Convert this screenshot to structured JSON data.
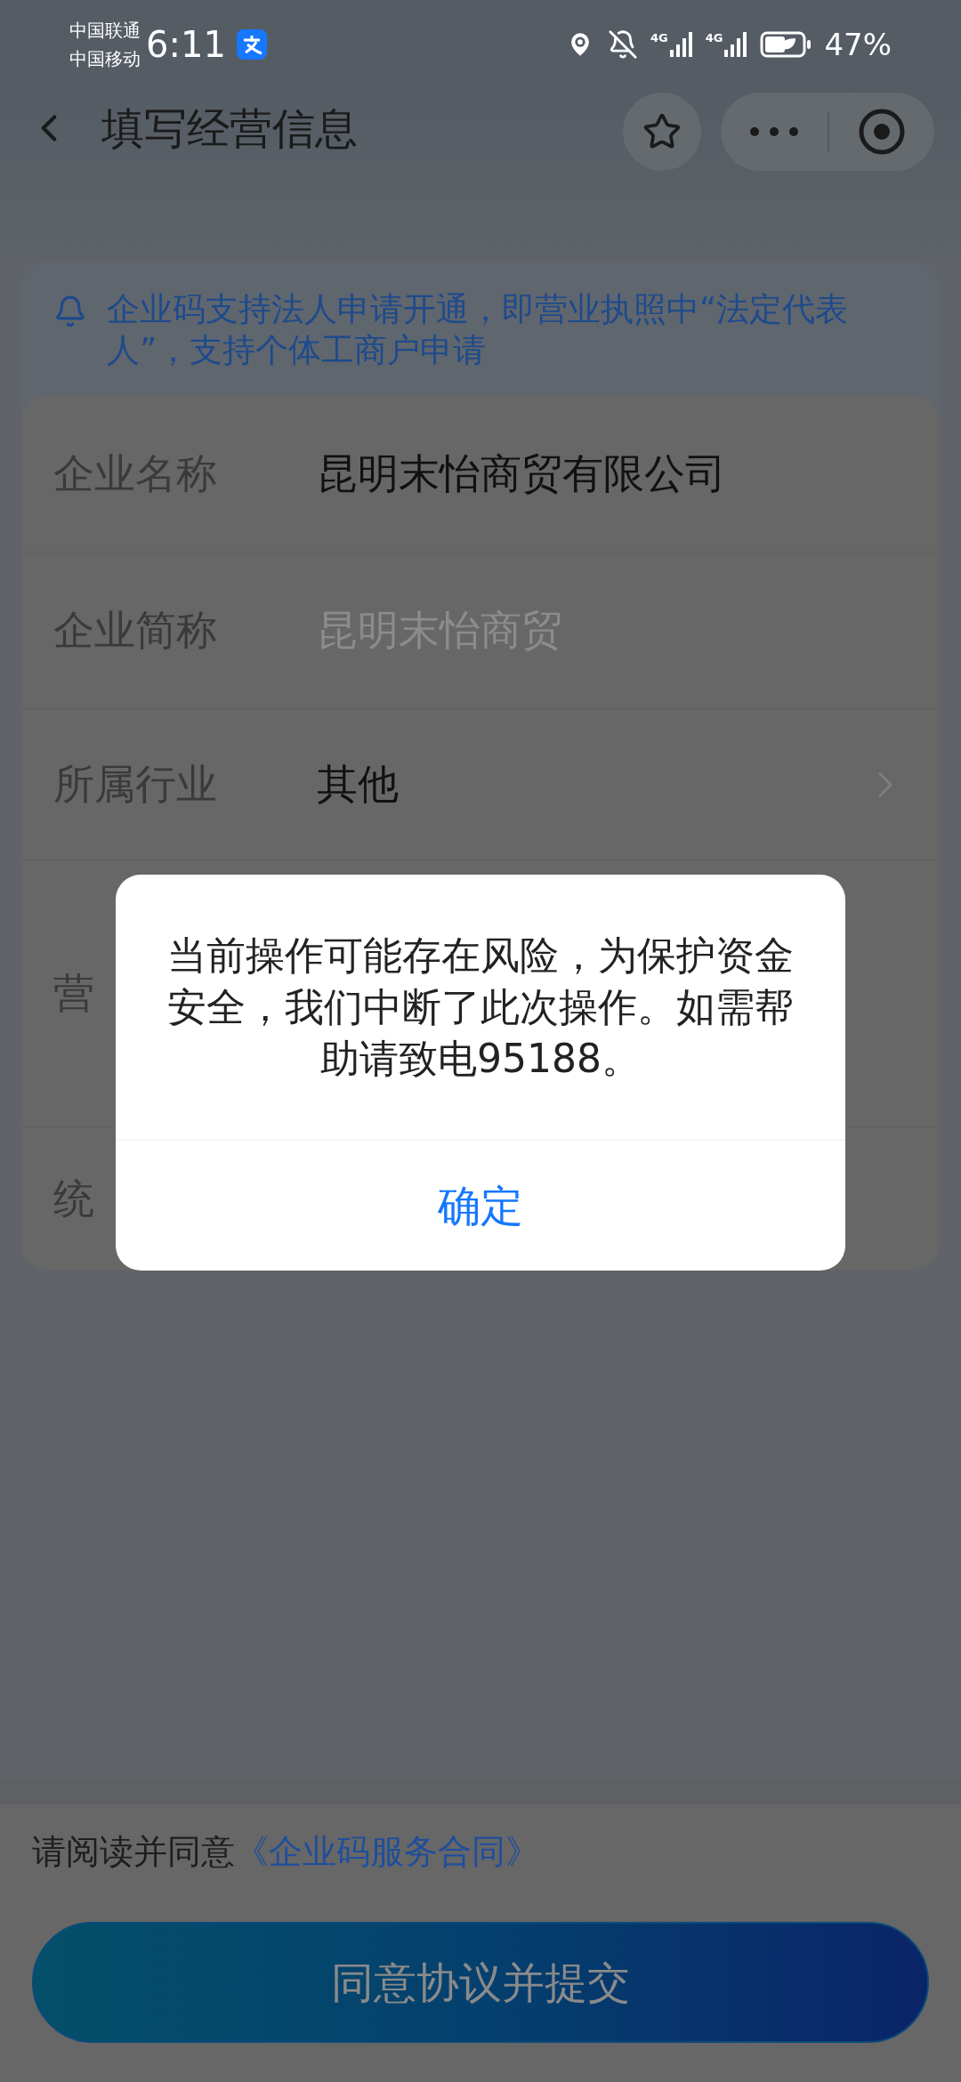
{
  "status_bar": {
    "carriers": [
      "中国联通",
      "中国移动"
    ],
    "time": "6:11",
    "network_labels": [
      "4G",
      "4G"
    ],
    "battery": "47%"
  },
  "header": {
    "title": "填写经营信息"
  },
  "notice": {
    "text": "企业码支持法人申请开通，即营业执照中“法定代表人”，支持个体工商户申请"
  },
  "form": {
    "rows": [
      {
        "kind": "text",
        "label": "企业名称",
        "value": "昆明末怡商贸有限公司"
      },
      {
        "kind": "text",
        "label": "企业简称",
        "placeholder": "昆明末怡商贸"
      },
      {
        "kind": "select",
        "label": "所属行业",
        "value": "其他"
      },
      {
        "kind": "tall",
        "label": "营"
      },
      {
        "kind": "text",
        "label": "统"
      }
    ]
  },
  "dialog": {
    "message": "当前操作可能存在风险，为保护资金安全，我们中断了此次操作。如需帮助请致电95188。",
    "button": "确定"
  },
  "agreement": {
    "prefix": "请阅读并同意",
    "link": "《企业码服务合同》"
  },
  "submit": {
    "label": "同意协议并提交"
  }
}
